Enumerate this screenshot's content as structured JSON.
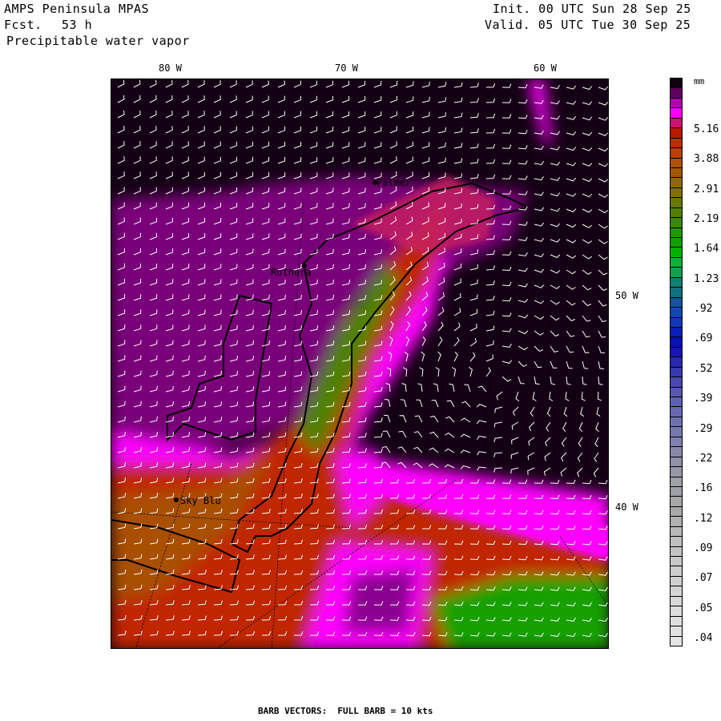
{
  "header": {
    "model": "AMPS Peninsula MPAS",
    "fcst_label": "Fcst.",
    "fcst_value": "53 h",
    "field": "Precipitable water vapor",
    "init": "Init. 00 UTC Sun 28 Sep 25",
    "valid": "Valid. 05 UTC Tue 30 Sep 25"
  },
  "map": {
    "lon_labels": [
      "80 W",
      "70 W",
      "60 W"
    ],
    "lat_labels": [
      "50 W",
      "40 W"
    ],
    "stations": [
      {
        "name": "Palmer"
      },
      {
        "name": "Rothera"
      },
      {
        "name": "Sky Blu"
      }
    ]
  },
  "colorbar": {
    "units": "mm",
    "labels": [
      "5.16",
      "3.88",
      "2.91",
      "2.19",
      "1.64",
      "1.23",
      ".92",
      ".69",
      ".52",
      ".39",
      ".29",
      ".22",
      ".16",
      ".12",
      ".09",
      ".07",
      ".05",
      ".04"
    ],
    "colors": [
      "#100010",
      "#600060",
      "#b000b0",
      "#ff00ff",
      "#d01070",
      "#b81800",
      "#b83000",
      "#b84000",
      "#b05000",
      "#a05800",
      "#906800",
      "#807000",
      "#687800",
      "#508000",
      "#388800",
      "#209800",
      "#10a000",
      "#00b000",
      "#10b030",
      "#10a050",
      "#108070",
      "#107080",
      "#105898",
      "#1048b0",
      "#1038b8",
      "#0820b8",
      "#0810b8",
      "#1818b0",
      "#2828b0",
      "#3838b0",
      "#4848b0",
      "#5858b0",
      "#6060b0",
      "#6868b0",
      "#7070b0",
      "#7878b0",
      "#8080b0",
      "#8888a8",
      "#9090a8",
      "#9898a8",
      "#a0a0a8",
      "#a0a0a8",
      "#a8a8a8",
      "#a8a8a8",
      "#b0b0b0",
      "#b8b8b8",
      "#c0c0c0",
      "#c4c4c4",
      "#c8c8c8",
      "#cccccc",
      "#d0d0d0",
      "#d4d4d4",
      "#d8d8d8",
      "#dcdcdc",
      "#e0e0e0",
      "#e0e0e0",
      "#e4e4e4"
    ]
  },
  "footer": {
    "barb_note": "BARB VECTORS:  FULL BARB = 10 kts"
  }
}
